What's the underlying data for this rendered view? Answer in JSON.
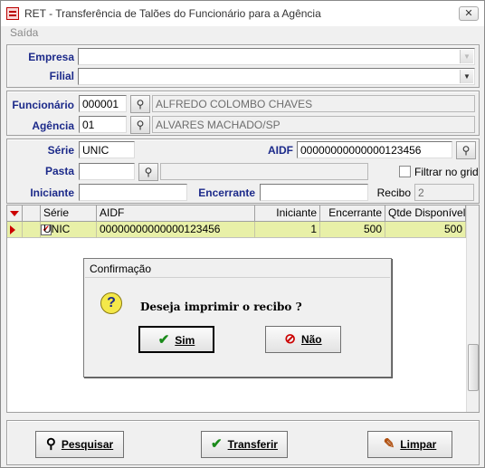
{
  "window": {
    "title": "RET - Transferência de Talões do Funcionário para a Agência",
    "close_glyph": "✕"
  },
  "menu": {
    "items": [
      {
        "label": "Saída"
      }
    ]
  },
  "filters": {
    "empresa_label": "Empresa",
    "empresa_value": "",
    "filial_label": "Filial",
    "filial_value": ""
  },
  "origin": {
    "funcionario_label": "Funcionário",
    "funcionario_code": "000001",
    "funcionario_name": "ALFREDO COLOMBO CHAVES",
    "agencia_label": "Agência",
    "agencia_code": "01",
    "agencia_name": "ALVARES MACHADO/SP"
  },
  "search": {
    "serie_label": "Série",
    "serie_value": "UNIC",
    "aidf_label": "AIDF",
    "aidf_value": "00000000000000123456",
    "pasta_label": "Pasta",
    "pasta_value": "",
    "pasta_desc": "",
    "filtrar_label": "Filtrar no grid",
    "iniciante_label": "Iniciante",
    "iniciante_value": "",
    "encerrante_label": "Encerrante",
    "encerrante_value": "",
    "recibo_label": "Recibo",
    "recibo_value": "2"
  },
  "grid": {
    "columns": [
      "Série",
      "AIDF",
      "Iniciante",
      "Encerrante",
      "Qtde Disponível"
    ],
    "rows": [
      {
        "checked": true,
        "serie": "UNIC",
        "aidf": "00000000000000123456",
        "iniciante": "1",
        "encerrante": "500",
        "qtde": "500"
      }
    ]
  },
  "dialog": {
    "title": "Confirmação",
    "icon": "question-icon",
    "message": "Deseja imprimir o recibo ?",
    "yes_label": "Sim",
    "no_label": "Não"
  },
  "actions": {
    "pesquisar_label": "Pesquisar",
    "transferir_label": "Transferir",
    "limpar_label": "Limpar"
  },
  "colors": {
    "label_blue": "#1c2a8a",
    "row_highlight": "#e8f0a8",
    "indicator_red": "#cc0000",
    "check_green": "#1a8a1a"
  }
}
